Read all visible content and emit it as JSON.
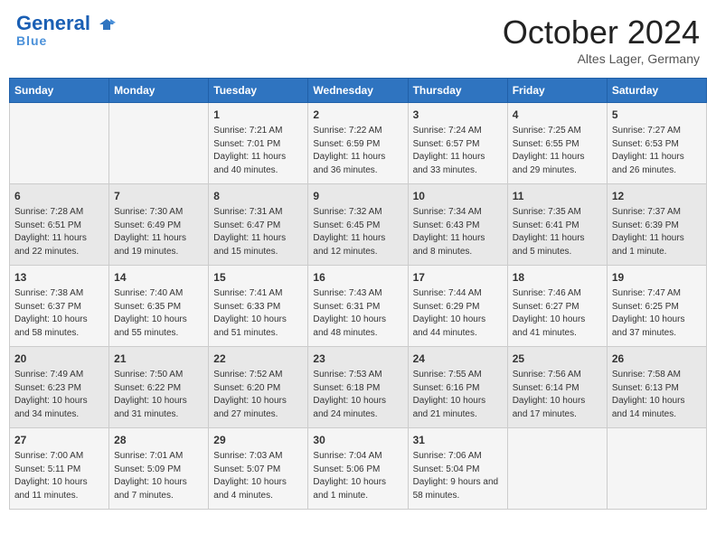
{
  "header": {
    "logo_general": "General",
    "logo_blue": "Blue",
    "month_title": "October 2024",
    "location": "Altes Lager, Germany"
  },
  "days_of_week": [
    "Sunday",
    "Monday",
    "Tuesday",
    "Wednesday",
    "Thursday",
    "Friday",
    "Saturday"
  ],
  "weeks": [
    [
      {
        "day": "",
        "info": ""
      },
      {
        "day": "",
        "info": ""
      },
      {
        "day": "1",
        "info": "Sunrise: 7:21 AM\nSunset: 7:01 PM\nDaylight: 11 hours and 40 minutes."
      },
      {
        "day": "2",
        "info": "Sunrise: 7:22 AM\nSunset: 6:59 PM\nDaylight: 11 hours and 36 minutes."
      },
      {
        "day": "3",
        "info": "Sunrise: 7:24 AM\nSunset: 6:57 PM\nDaylight: 11 hours and 33 minutes."
      },
      {
        "day": "4",
        "info": "Sunrise: 7:25 AM\nSunset: 6:55 PM\nDaylight: 11 hours and 29 minutes."
      },
      {
        "day": "5",
        "info": "Sunrise: 7:27 AM\nSunset: 6:53 PM\nDaylight: 11 hours and 26 minutes."
      }
    ],
    [
      {
        "day": "6",
        "info": "Sunrise: 7:28 AM\nSunset: 6:51 PM\nDaylight: 11 hours and 22 minutes."
      },
      {
        "day": "7",
        "info": "Sunrise: 7:30 AM\nSunset: 6:49 PM\nDaylight: 11 hours and 19 minutes."
      },
      {
        "day": "8",
        "info": "Sunrise: 7:31 AM\nSunset: 6:47 PM\nDaylight: 11 hours and 15 minutes."
      },
      {
        "day": "9",
        "info": "Sunrise: 7:32 AM\nSunset: 6:45 PM\nDaylight: 11 hours and 12 minutes."
      },
      {
        "day": "10",
        "info": "Sunrise: 7:34 AM\nSunset: 6:43 PM\nDaylight: 11 hours and 8 minutes."
      },
      {
        "day": "11",
        "info": "Sunrise: 7:35 AM\nSunset: 6:41 PM\nDaylight: 11 hours and 5 minutes."
      },
      {
        "day": "12",
        "info": "Sunrise: 7:37 AM\nSunset: 6:39 PM\nDaylight: 11 hours and 1 minute."
      }
    ],
    [
      {
        "day": "13",
        "info": "Sunrise: 7:38 AM\nSunset: 6:37 PM\nDaylight: 10 hours and 58 minutes."
      },
      {
        "day": "14",
        "info": "Sunrise: 7:40 AM\nSunset: 6:35 PM\nDaylight: 10 hours and 55 minutes."
      },
      {
        "day": "15",
        "info": "Sunrise: 7:41 AM\nSunset: 6:33 PM\nDaylight: 10 hours and 51 minutes."
      },
      {
        "day": "16",
        "info": "Sunrise: 7:43 AM\nSunset: 6:31 PM\nDaylight: 10 hours and 48 minutes."
      },
      {
        "day": "17",
        "info": "Sunrise: 7:44 AM\nSunset: 6:29 PM\nDaylight: 10 hours and 44 minutes."
      },
      {
        "day": "18",
        "info": "Sunrise: 7:46 AM\nSunset: 6:27 PM\nDaylight: 10 hours and 41 minutes."
      },
      {
        "day": "19",
        "info": "Sunrise: 7:47 AM\nSunset: 6:25 PM\nDaylight: 10 hours and 37 minutes."
      }
    ],
    [
      {
        "day": "20",
        "info": "Sunrise: 7:49 AM\nSunset: 6:23 PM\nDaylight: 10 hours and 34 minutes."
      },
      {
        "day": "21",
        "info": "Sunrise: 7:50 AM\nSunset: 6:22 PM\nDaylight: 10 hours and 31 minutes."
      },
      {
        "day": "22",
        "info": "Sunrise: 7:52 AM\nSunset: 6:20 PM\nDaylight: 10 hours and 27 minutes."
      },
      {
        "day": "23",
        "info": "Sunrise: 7:53 AM\nSunset: 6:18 PM\nDaylight: 10 hours and 24 minutes."
      },
      {
        "day": "24",
        "info": "Sunrise: 7:55 AM\nSunset: 6:16 PM\nDaylight: 10 hours and 21 minutes."
      },
      {
        "day": "25",
        "info": "Sunrise: 7:56 AM\nSunset: 6:14 PM\nDaylight: 10 hours and 17 minutes."
      },
      {
        "day": "26",
        "info": "Sunrise: 7:58 AM\nSunset: 6:13 PM\nDaylight: 10 hours and 14 minutes."
      }
    ],
    [
      {
        "day": "27",
        "info": "Sunrise: 7:00 AM\nSunset: 5:11 PM\nDaylight: 10 hours and 11 minutes."
      },
      {
        "day": "28",
        "info": "Sunrise: 7:01 AM\nSunset: 5:09 PM\nDaylight: 10 hours and 7 minutes."
      },
      {
        "day": "29",
        "info": "Sunrise: 7:03 AM\nSunset: 5:07 PM\nDaylight: 10 hours and 4 minutes."
      },
      {
        "day": "30",
        "info": "Sunrise: 7:04 AM\nSunset: 5:06 PM\nDaylight: 10 hours and 1 minute."
      },
      {
        "day": "31",
        "info": "Sunrise: 7:06 AM\nSunset: 5:04 PM\nDaylight: 9 hours and 58 minutes."
      },
      {
        "day": "",
        "info": ""
      },
      {
        "day": "",
        "info": ""
      }
    ]
  ]
}
